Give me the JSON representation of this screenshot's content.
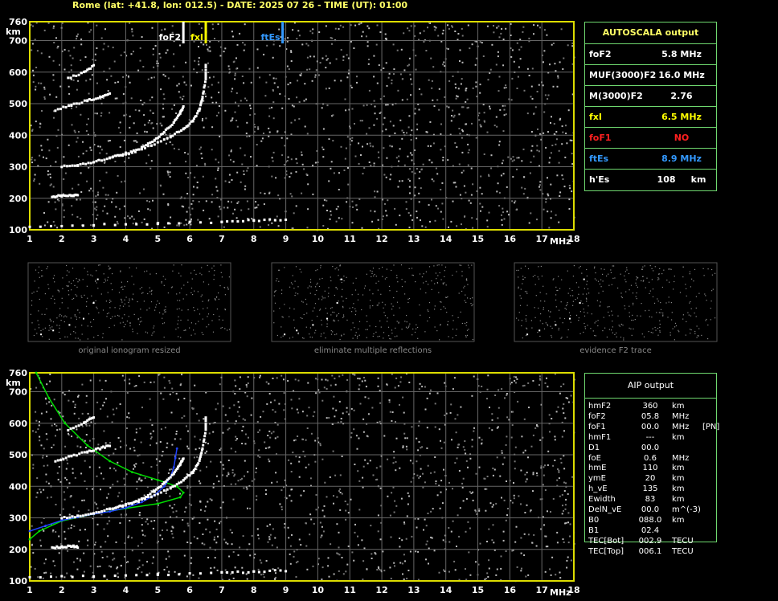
{
  "header": {
    "text": "Rome (lat: +41.8, lon: 012.5) - DATE: 2025 07 26 - TIME (UT): 01:00"
  },
  "chart_data": [
    {
      "type": "scatter",
      "title": "",
      "xlabel": "MHz",
      "ylabel": "km",
      "xlim": [
        1,
        18
      ],
      "ylim": [
        100,
        760
      ],
      "x_ticks": [
        "1",
        "2",
        "3",
        "4",
        "5",
        "6",
        "7",
        "8",
        "9",
        "10",
        "11",
        "12",
        "13",
        "14",
        "15",
        "16",
        "17",
        "18"
      ],
      "y_ticks": [
        "100",
        "200",
        "300",
        "400",
        "500",
        "600",
        "700",
        "760"
      ],
      "grid": true,
      "markers": [
        {
          "label": "foF2",
          "x": 5.8,
          "color": "#ffffff"
        },
        {
          "label": "fxI",
          "x": 6.5,
          "color": "#ffff00"
        },
        {
          "label": "ftEs",
          "x": 8.9,
          "color": "#3399ff"
        }
      ],
      "series": [
        {
          "points": [
            [
              1.7,
              205
            ],
            [
              2.0,
              208
            ],
            [
              2.3,
              210
            ],
            [
              2.5,
              208
            ]
          ]
        },
        {
          "points": [
            [
              2.0,
              300
            ],
            [
              2.5,
              305
            ],
            [
              3.0,
              315
            ],
            [
              3.5,
              328
            ],
            [
              4.0,
              342
            ],
            [
              4.5,
              360
            ],
            [
              4.9,
              385
            ],
            [
              5.2,
              410
            ],
            [
              5.5,
              440
            ],
            [
              5.7,
              470
            ],
            [
              5.8,
              490
            ]
          ]
        },
        {
          "points": [
            [
              3.6,
              330
            ],
            [
              4.2,
              345
            ],
            [
              4.8,
              368
            ],
            [
              5.4,
              395
            ],
            [
              5.8,
              420
            ],
            [
              6.1,
              445
            ],
            [
              6.3,
              480
            ],
            [
              6.4,
              520
            ],
            [
              6.5,
              580
            ],
            [
              6.5,
              620
            ]
          ]
        },
        {
          "points": [
            [
              1.8,
              480
            ],
            [
              2.3,
              495
            ],
            [
              2.8,
              510
            ],
            [
              3.2,
              520
            ],
            [
              3.5,
              530
            ]
          ]
        },
        {
          "points": [
            [
              2.2,
              580
            ],
            [
              2.7,
              600
            ],
            [
              3.0,
              620
            ]
          ]
        },
        {
          "points": [
            [
              1.0,
              110
            ],
            [
              3.0,
              115
            ],
            [
              5.0,
              120
            ],
            [
              7.0,
              125
            ],
            [
              8.0,
              130
            ],
            [
              9.0,
              132
            ]
          ]
        }
      ]
    },
    {
      "type": "line",
      "title": "",
      "xlabel": "MHz",
      "ylabel": "km",
      "xlim": [
        1,
        18
      ],
      "ylim": [
        100,
        760
      ],
      "x_ticks": [
        "1",
        "2",
        "3",
        "4",
        "5",
        "6",
        "7",
        "8",
        "9",
        "10",
        "11",
        "12",
        "13",
        "14",
        "15",
        "16",
        "17",
        "18"
      ],
      "y_ticks": [
        "100",
        "200",
        "300",
        "400",
        "500",
        "600",
        "700",
        "760"
      ],
      "grid": true,
      "series": [
        {
          "color": "#00dd00",
          "points": [
            [
              1.2,
              760
            ],
            [
              1.6,
              680
            ],
            [
              2.1,
              600
            ],
            [
              2.8,
              530
            ],
            [
              3.5,
              480
            ],
            [
              4.2,
              445
            ],
            [
              5.0,
              420
            ],
            [
              5.6,
              400
            ],
            [
              5.8,
              380
            ],
            [
              5.7,
              365
            ],
            [
              5.0,
              345
            ],
            [
              4.0,
              330
            ],
            [
              3.0,
              312
            ],
            [
              2.0,
              290
            ],
            [
              1.3,
              258
            ],
            [
              1.0,
              232
            ]
          ]
        },
        {
          "color": "#2244ff",
          "points": [
            [
              1.0,
              258
            ],
            [
              1.5,
              275
            ],
            [
              2.0,
              292
            ],
            [
              2.5,
              302
            ],
            [
              3.0,
              312
            ],
            [
              3.5,
              320
            ],
            [
              4.0,
              332
            ],
            [
              4.5,
              350
            ],
            [
              4.9,
              372
            ],
            [
              5.2,
              400
            ],
            [
              5.4,
              430
            ],
            [
              5.5,
              460
            ],
            [
              5.55,
              490
            ],
            [
              5.6,
              520
            ]
          ]
        },
        {
          "points": [
            [
              1.7,
              205
            ],
            [
              2.0,
              208
            ],
            [
              2.3,
              210
            ],
            [
              2.5,
              208
            ]
          ]
        },
        {
          "points": [
            [
              2.0,
              300
            ],
            [
              2.5,
              305
            ],
            [
              3.0,
              315
            ],
            [
              3.5,
              328
            ],
            [
              4.0,
              342
            ],
            [
              4.5,
              360
            ],
            [
              4.9,
              385
            ],
            [
              5.2,
              410
            ],
            [
              5.5,
              440
            ],
            [
              5.7,
              470
            ],
            [
              5.8,
              490
            ]
          ]
        },
        {
          "points": [
            [
              3.6,
              330
            ],
            [
              4.2,
              345
            ],
            [
              4.8,
              368
            ],
            [
              5.4,
              395
            ],
            [
              5.8,
              420
            ],
            [
              6.1,
              445
            ],
            [
              6.3,
              480
            ],
            [
              6.4,
              520
            ],
            [
              6.5,
              580
            ],
            [
              6.5,
              620
            ]
          ]
        },
        {
          "points": [
            [
              1.8,
              480
            ],
            [
              2.3,
              495
            ],
            [
              2.8,
              510
            ],
            [
              3.2,
              520
            ],
            [
              3.5,
              530
            ]
          ]
        },
        {
          "points": [
            [
              2.2,
              580
            ],
            [
              2.7,
              600
            ],
            [
              3.0,
              620
            ]
          ]
        },
        {
          "points": [
            [
              1.0,
              110
            ],
            [
              3.0,
              115
            ],
            [
              5.0,
              120
            ],
            [
              7.0,
              125
            ],
            [
              8.0,
              130
            ],
            [
              9.0,
              132
            ]
          ]
        }
      ]
    }
  ],
  "thumbnails": [
    {
      "caption": "original ionogram resized"
    },
    {
      "caption": "eliminate multiple reflections"
    },
    {
      "caption": "evidence F2 trace"
    }
  ],
  "autoscala": {
    "title": "AUTOSCALA output",
    "rows": [
      {
        "label": "foF2",
        "value": "5.8 MHz",
        "color": "#ffffff"
      },
      {
        "label": "MUF(3000)F2",
        "value": "16.0 MHz",
        "color": "#ffffff"
      },
      {
        "label": "M(3000)F2",
        "value": "2.76",
        "color": "#ffffff"
      },
      {
        "label": "fxI",
        "value": "6.5 MHz",
        "color": "#ffff00"
      },
      {
        "label": "foF1",
        "value": "NO",
        "color": "#ff2020"
      },
      {
        "label": "ftEs",
        "value": "8.9 MHz",
        "color": "#3399ff"
      },
      {
        "label": "h'Es",
        "value": "108     km",
        "color": "#ffffff"
      }
    ]
  },
  "aip": {
    "title": "AIP output",
    "rows": [
      {
        "name": "hmF2",
        "value": "360",
        "unit": "km",
        "extra": ""
      },
      {
        "name": "foF2",
        "value": "05.8",
        "unit": "MHz",
        "extra": ""
      },
      {
        "name": "foF1",
        "value": "00.0",
        "unit": "MHz",
        "extra": "[PN]"
      },
      {
        "name": "hmF1",
        "value": "---",
        "unit": "km",
        "extra": ""
      },
      {
        "name": "D1",
        "value": "00.0",
        "unit": "",
        "extra": ""
      },
      {
        "name": "foE",
        "value": "0.6",
        "unit": "MHz",
        "extra": ""
      },
      {
        "name": "hmE",
        "value": "110",
        "unit": "km",
        "extra": ""
      },
      {
        "name": "ymE",
        "value": "20",
        "unit": "km",
        "extra": ""
      },
      {
        "name": "h_vE",
        "value": "135",
        "unit": "km",
        "extra": ""
      },
      {
        "name": "Ewidth",
        "value": "83",
        "unit": "km",
        "extra": ""
      },
      {
        "name": "DelN_vE",
        "value": "00.0",
        "unit": "m^(-3)",
        "extra": ""
      },
      {
        "name": "B0",
        "value": "088.0",
        "unit": "km",
        "extra": ""
      },
      {
        "name": "B1",
        "value": "02.4",
        "unit": "",
        "extra": ""
      },
      {
        "name": "TEC[Bot]",
        "value": "002.9",
        "unit": "TECU",
        "extra": ""
      },
      {
        "name": "TEC[Top]",
        "value": "006.1",
        "unit": "TECU",
        "extra": ""
      }
    ]
  }
}
